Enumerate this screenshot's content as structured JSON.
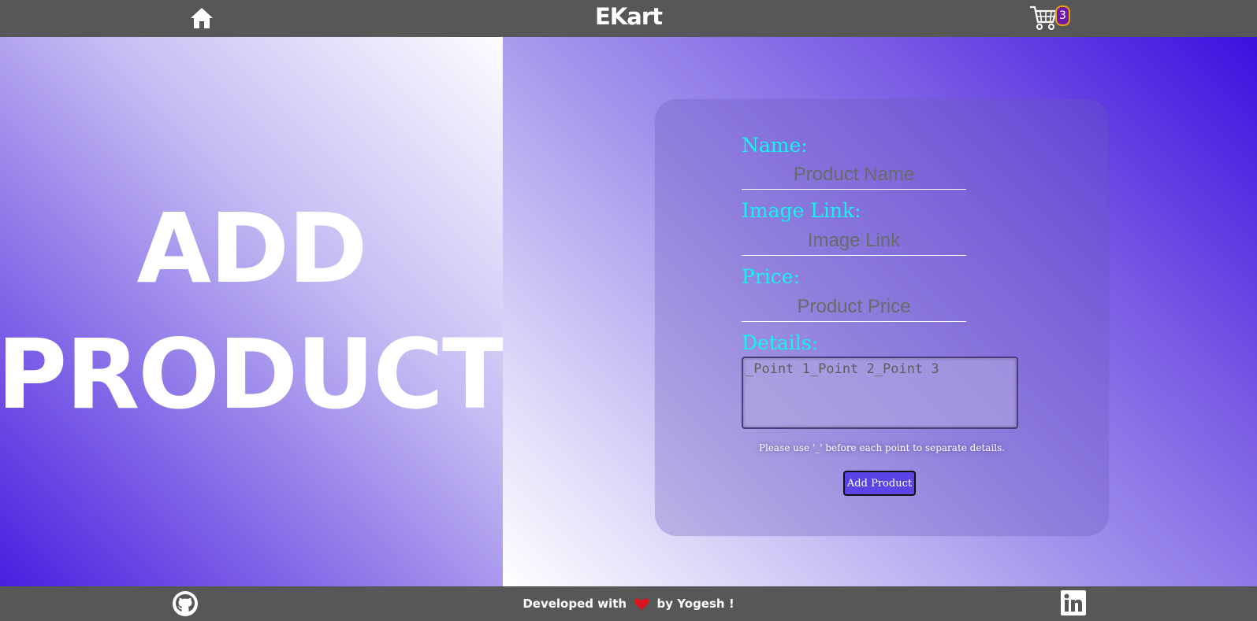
{
  "header": {
    "brand": "EKart",
    "cart_count": "3"
  },
  "hero": {
    "line1": "ADD",
    "line2": "PRODUCT"
  },
  "form": {
    "name_label": "Name:",
    "name_placeholder": "Product Name",
    "image_label": "Image Link:",
    "image_placeholder": "Image Link",
    "price_label": "Price:",
    "price_placeholder": "Product Price",
    "details_label": "Details:",
    "details_placeholder": "_Point 1_Point 2_Point 3",
    "hint": "Please use '_' before each point to separate details.",
    "submit_label": "Add Product"
  },
  "footer": {
    "credit_prefix": "Developed with",
    "credit_suffix": "by Yogesh !"
  },
  "colors": {
    "label": "#12f4ef",
    "bar": "#575757",
    "button": "#5b44e6"
  },
  "icons": [
    "home-icon",
    "cart-icon",
    "github-icon",
    "heart-icon",
    "linkedin-icon"
  ]
}
